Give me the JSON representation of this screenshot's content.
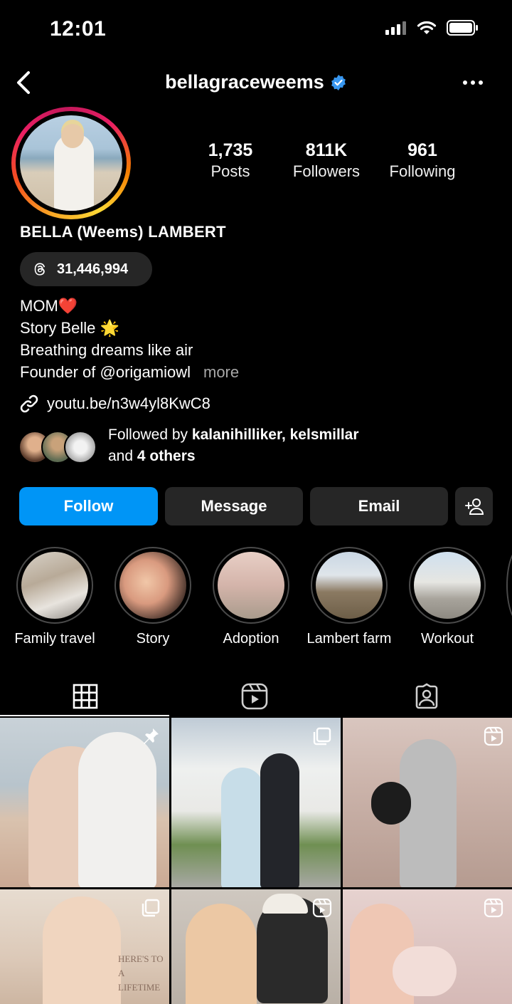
{
  "status_bar": {
    "time": "12:01"
  },
  "header": {
    "username": "bellagraceweems",
    "verified": true
  },
  "stats": [
    {
      "value": "1,735",
      "label": "Posts"
    },
    {
      "value": "811K",
      "label": "Followers"
    },
    {
      "value": "961",
      "label": "Following"
    }
  ],
  "profile": {
    "full_name": "BELLA (Weems) LAMBERT",
    "threads_count": "31,446,994",
    "bio_lines": [
      "MOM❤️",
      "Story Belle 🌟",
      "Breathing dreams like air",
      "Founder of @origamiowl"
    ],
    "bio_more": "more",
    "link": "youtu.be/n3w4yl8KwC8",
    "followed_by_prefix": "Followed by ",
    "followed_by_names": "kalanihilliker, kelsmillar",
    "followed_by_and": "and ",
    "followed_by_others": "4 others"
  },
  "actions": {
    "follow": "Follow",
    "message": "Message",
    "email": "Email"
  },
  "highlights": [
    {
      "label": "Family travel"
    },
    {
      "label": "Story"
    },
    {
      "label": "Adoption"
    },
    {
      "label": "Lambert farm"
    },
    {
      "label": "Workout"
    }
  ],
  "tabs": [
    {
      "icon": "grid-icon",
      "active": true
    },
    {
      "icon": "reels-icon",
      "active": false
    },
    {
      "icon": "tagged-icon",
      "active": false
    }
  ],
  "grid_posts": [
    {
      "badge": "pin-icon"
    },
    {
      "badge": "carousel-icon"
    },
    {
      "badge": "reel-icon"
    },
    {
      "badge": "carousel-icon",
      "overlay_text": "HERE'S TO A LIFETIME"
    },
    {
      "badge": "reel-icon"
    },
    {
      "badge": "reel-icon"
    }
  ],
  "colors": {
    "accent": "#0095f6",
    "button_bg": "#262626",
    "verified": "#3897f0"
  }
}
